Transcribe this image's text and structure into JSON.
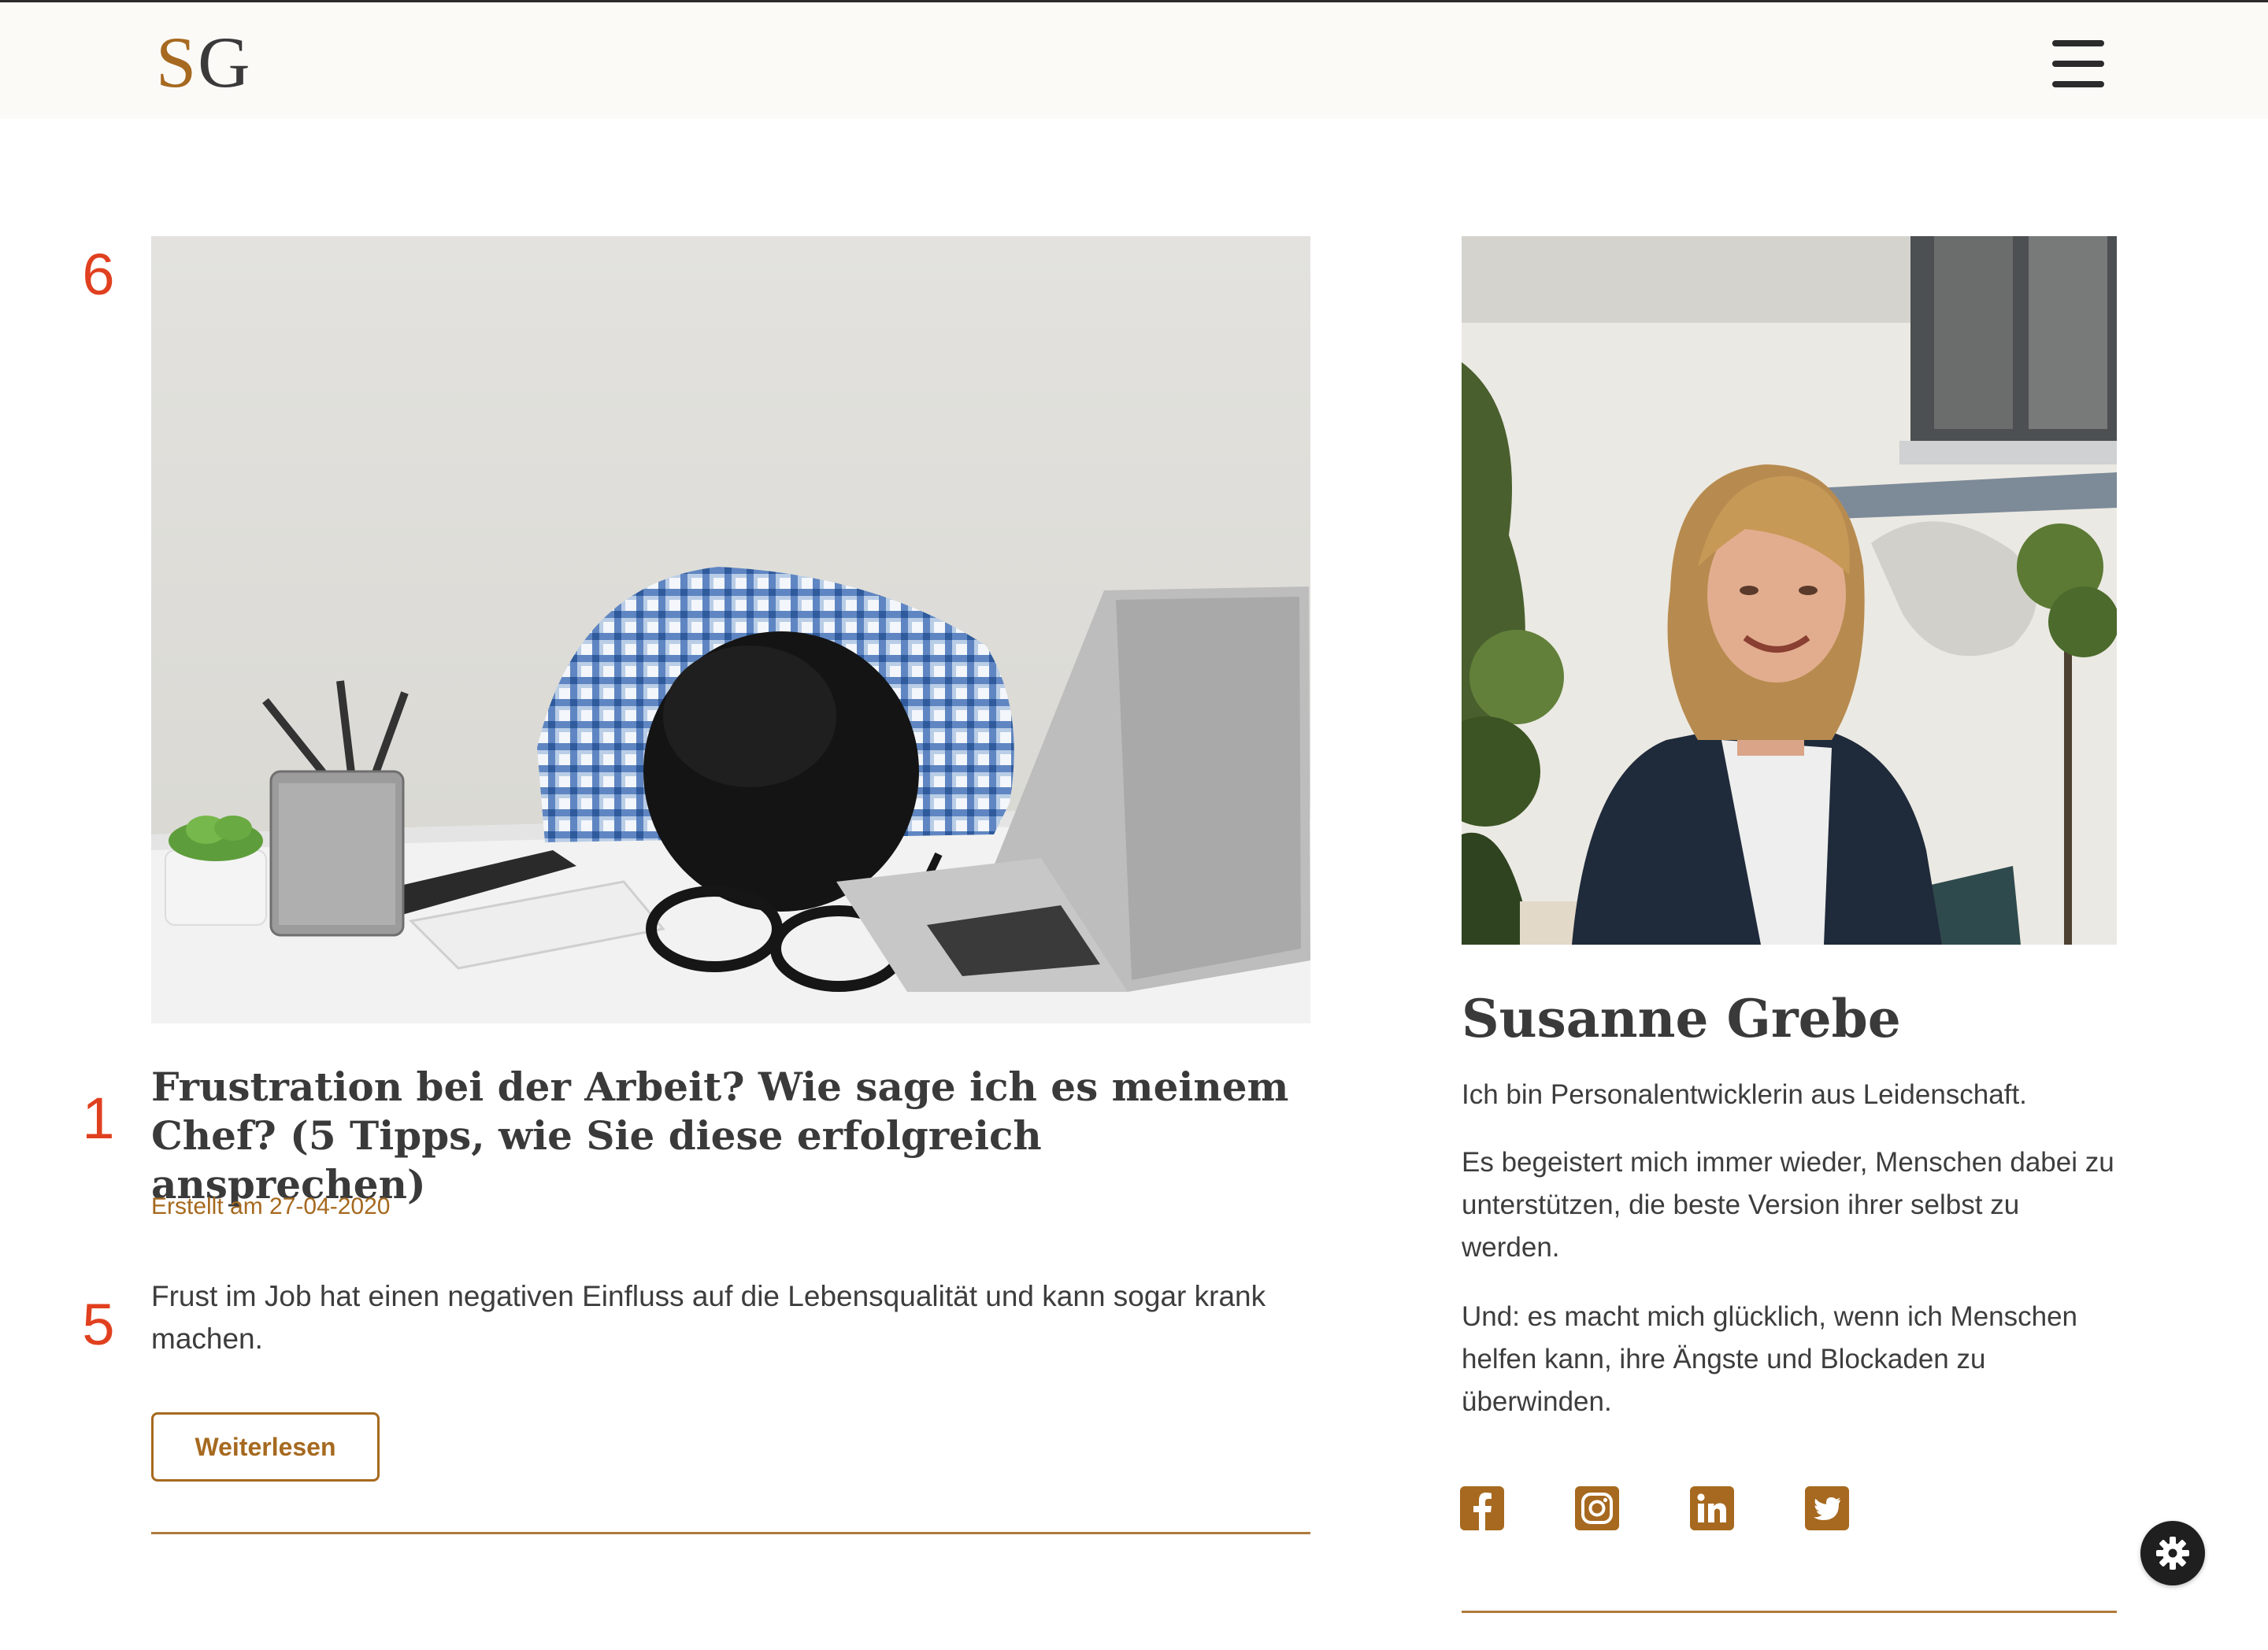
{
  "header": {
    "logo_first": "S",
    "logo_second": "G",
    "menu_icon": "hamburger-menu-icon"
  },
  "markers": {
    "image": "6",
    "title": "1",
    "excerpt": "5"
  },
  "article": {
    "image_alt": "Person mit Kopf auf dem Schreibtisch neben Laptop",
    "title": "Frustration bei der Arbeit? Wie sage ich es meinem Chef? (5 Tipps, wie Sie diese erfolgreich ansprechen)",
    "date": "Erstellt am 27-04-2020",
    "excerpt": "Frust im Job hat einen negativen Einfluss auf die Lebensqualität und kann sogar krank machen.",
    "read_more_label": "Weiterlesen"
  },
  "sidebar": {
    "name": "Susanne Grebe",
    "bio": [
      "Ich bin Personalentwicklerin aus Leidenschaft.",
      "Es begeistert mich immer wieder, Menschen dabei zu unterstützen, die beste Version ihrer selbst zu werden.",
      "Und: es macht mich glücklich, wenn ich Menschen helfen kann, ihre Ängste und Blockaden zu überwinden."
    ],
    "social": [
      "facebook-icon",
      "instagram-icon",
      "linkedin-icon",
      "twitter-icon"
    ]
  },
  "colors": {
    "accent": "#a6691f",
    "marker": "#e0401f",
    "text": "#3a3a3a",
    "header_bg": "#fbfaf7"
  },
  "cookie_settings_icon": "gear-icon"
}
